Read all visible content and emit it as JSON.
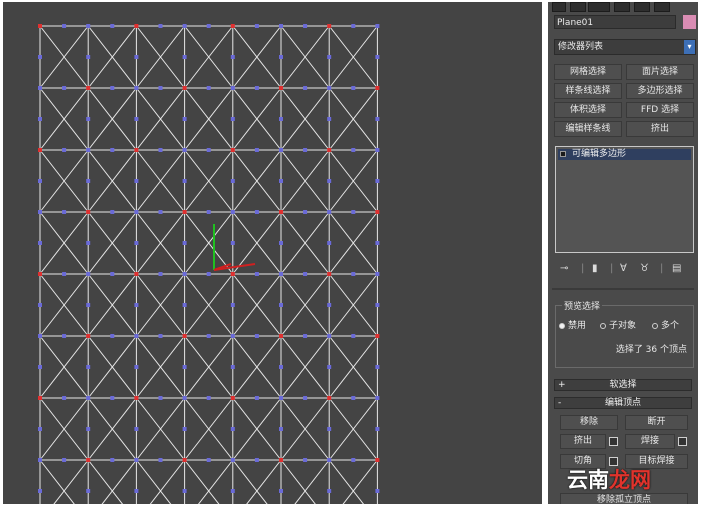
{
  "panel": {
    "object_name": "Plane01",
    "modifier_list": "修改器列表",
    "modifier_buttons": [
      "网格选择",
      "面片选择",
      "样条线选择",
      "多边形选择",
      "体积选择",
      "FFD 选择",
      "编辑样条线",
      "挤出"
    ],
    "stack_item": "可编辑多边形",
    "stack_tools": [
      "pin-icon",
      "show-end-result-icon",
      "make-unique-icon",
      "remove-modifier-icon",
      "configure-icon"
    ],
    "preview_selection": {
      "title": "预览选择",
      "options": [
        "禁用",
        "子对象",
        "多个"
      ],
      "selected": "禁用",
      "info": "选择了 36 个顶点"
    },
    "soft_selection": {
      "sign": "+",
      "label": "软选择"
    },
    "edit_vertices": {
      "sign": "-",
      "label": "编辑顶点",
      "buttons": [
        "移除",
        "断开",
        "挤出",
        "焊接",
        "切角",
        "目标焊接",
        "移除孤立顶点"
      ]
    }
  },
  "watermark": {
    "part1": "云南",
    "part2": "龙网"
  },
  "colors": {
    "viewport_bg": "#444444",
    "mesh_line": "#e8e8e8",
    "vertex_red": "#e03030",
    "vertex_blue": "#6a6ad8",
    "gizmo_green": "#20c020",
    "gizmo_red": "#d02020"
  }
}
